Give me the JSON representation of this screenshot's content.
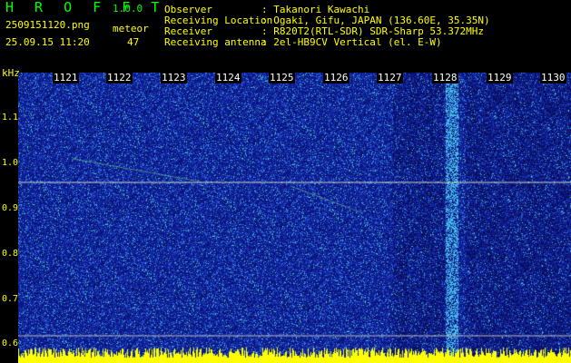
{
  "app": {
    "name": "H R O F F T",
    "version": "1.0.0"
  },
  "file": {
    "name": "2509151120.png",
    "datetime": "25.09.15 11:20"
  },
  "meteor": {
    "label": "meteor",
    "count": "47"
  },
  "info": [
    {
      "key": "Observer",
      "value": ": Takanori Kawachi"
    },
    {
      "key": "Receiving Location",
      "value": ": Ogaki, Gifu, JAPAN (136.60E, 35.35N)"
    },
    {
      "key": "Receiver",
      "value": ": R820T2(RTL-SDR) SDR-Sharp 53.372MHz"
    },
    {
      "key": "Receiving antenna",
      "value": ": 2el-HB9CV Vertical (el. E-W)"
    }
  ],
  "axes": {
    "y_unit": "kHz",
    "y_ticks": [
      "1.1",
      "1.0",
      "0.9",
      "0.8",
      "0.7",
      "0.6"
    ],
    "x_ticks": [
      "1121",
      "1122",
      "1123",
      "1124",
      "1125",
      "1126",
      "1127",
      "1128",
      "1129",
      "1130"
    ]
  },
  "colors": {
    "background": "#000000",
    "label_yellow": "#ffff00",
    "brand_green": "#00ff00",
    "spectrum_base": "#0a1e8c"
  }
}
